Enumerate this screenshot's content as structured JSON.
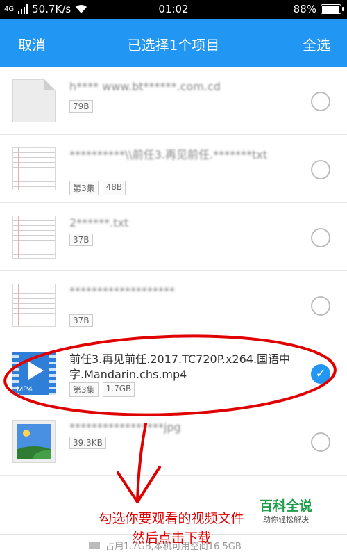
{
  "status_bar": {
    "network": "4G",
    "speed": "50.7K/s",
    "time": "01:02",
    "battery_text": "88%",
    "battery_level": 0.88
  },
  "app_bar": {
    "cancel_label": "取消",
    "title": "已选择1个项目",
    "select_all_label": "全选",
    "color": "#2196f3"
  },
  "files": [
    {
      "name": "h**** www.bt******.com.cd",
      "tags": [
        "79B"
      ],
      "icon": "document-icon",
      "selected": false
    },
    {
      "name": "**********\\\\前任3.再见前任.*******txt",
      "tags": [
        "第3集",
        "48B"
      ],
      "icon": "text-file-icon",
      "selected": false
    },
    {
      "name": "2******.txt",
      "tags": [
        "37B"
      ],
      "icon": "text-file-icon",
      "selected": false
    },
    {
      "name": "*******************",
      "tags": [
        "37B"
      ],
      "icon": "text-file-icon",
      "selected": false
    },
    {
      "name": "前任3.再见前任.2017.TC720P.x264.国语中字.Mandarin.chs.mp4",
      "tags": [
        "第3集",
        "1.7GB"
      ],
      "icon": "mp4-video-icon",
      "icon_label": "MP4",
      "selected": true
    },
    {
      "name": "*****************jpg",
      "tags": [
        "39.3KB"
      ],
      "icon": "image-file-icon",
      "selected": false
    }
  ],
  "annotation": {
    "line1": "勾选你要观看的视频文件",
    "line2": "然后点击下载",
    "color": "#e00000"
  },
  "watermark": {
    "title": "百科全说",
    "subtitle": "助你轻松解决"
  },
  "bottom_bar": {
    "text": "占用1.7GB,本机可用空间16.5GB"
  }
}
